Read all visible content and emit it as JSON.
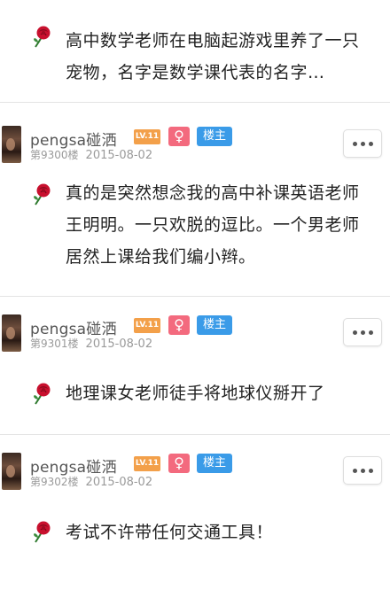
{
  "posts": [
    {
      "text": "高中数学老师在电脑起游戏里养了一只宠物，名字是数学课代表的名字…"
    },
    {
      "username": "pengsa碰洒",
      "level": "LV.11",
      "gender": "♀",
      "role": "楼主",
      "floor": "第9300楼",
      "date": "2015-08-02",
      "text": "真的是突然想念我的高中补课英语老师王明明。一只欢脱的逗比。一个男老师居然上课给我们编小辫。"
    },
    {
      "username": "pengsa碰洒",
      "level": "LV.11",
      "gender": "♀",
      "role": "楼主",
      "floor": "第9301楼",
      "date": "2015-08-02",
      "text": "地理课女老师徒手将地球仪掰开了"
    },
    {
      "username": "pengsa碰洒",
      "level": "LV.11",
      "gender": "♀",
      "role": "楼主",
      "floor": "第9302楼",
      "date": "2015-08-02",
      "text": "考试不许带任何交通工具！"
    }
  ],
  "icons": {
    "emoji": "rose-icon",
    "more": "more-icon"
  },
  "colors": {
    "level_badge": "#f3a04a",
    "gender_badge": "#f36a7e",
    "owner_badge": "#3a9be8"
  }
}
